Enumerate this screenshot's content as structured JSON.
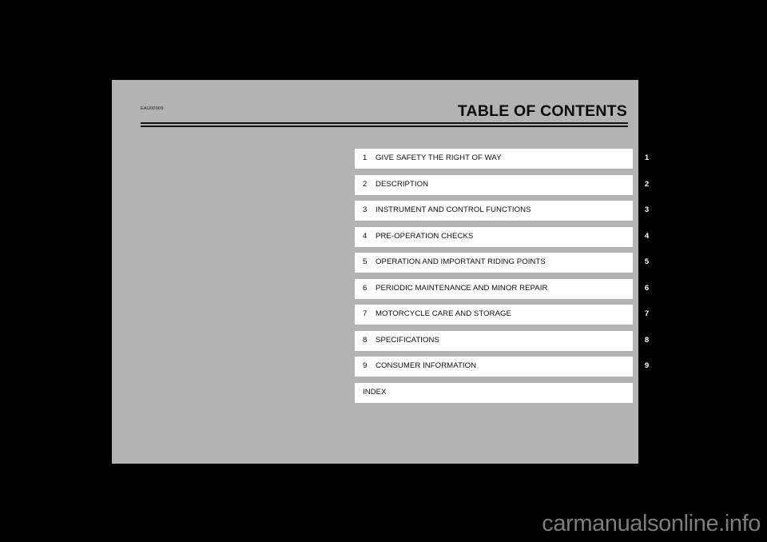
{
  "page": {
    "doc_code": "EAU00009",
    "title": "TABLE OF CONTENTS",
    "background_color": "#b3b3b3",
    "surround_color": "#000000"
  },
  "contents": {
    "rows": [
      {
        "number": "1",
        "label": "GIVE SAFETY THE RIGHT OF WAY",
        "tab": "1"
      },
      {
        "number": "2",
        "label": "DESCRIPTION",
        "tab": "2"
      },
      {
        "number": "3",
        "label": "INSTRUMENT AND CONTROL FUNCTIONS",
        "tab": "3"
      },
      {
        "number": "4",
        "label": "PRE-OPERATION CHECKS",
        "tab": "4"
      },
      {
        "number": "5",
        "label": "OPERATION AND IMPORTANT RIDING POINTS",
        "tab": "5"
      },
      {
        "number": "6",
        "label": "PERIODIC MAINTENANCE AND MINOR REPAIR",
        "tab": "6"
      },
      {
        "number": "7",
        "label": "MOTORCYCLE CARE AND STORAGE",
        "tab": "7"
      },
      {
        "number": "8",
        "label": "SPECIFICATIONS",
        "tab": "8"
      },
      {
        "number": "9",
        "label": "CONSUMER INFORMATION",
        "tab": "9"
      },
      {
        "number": "",
        "label": "INDEX",
        "tab": ""
      }
    ]
  },
  "watermark": {
    "text": "carmanualsonline.info",
    "color": "#7d7d7d"
  }
}
